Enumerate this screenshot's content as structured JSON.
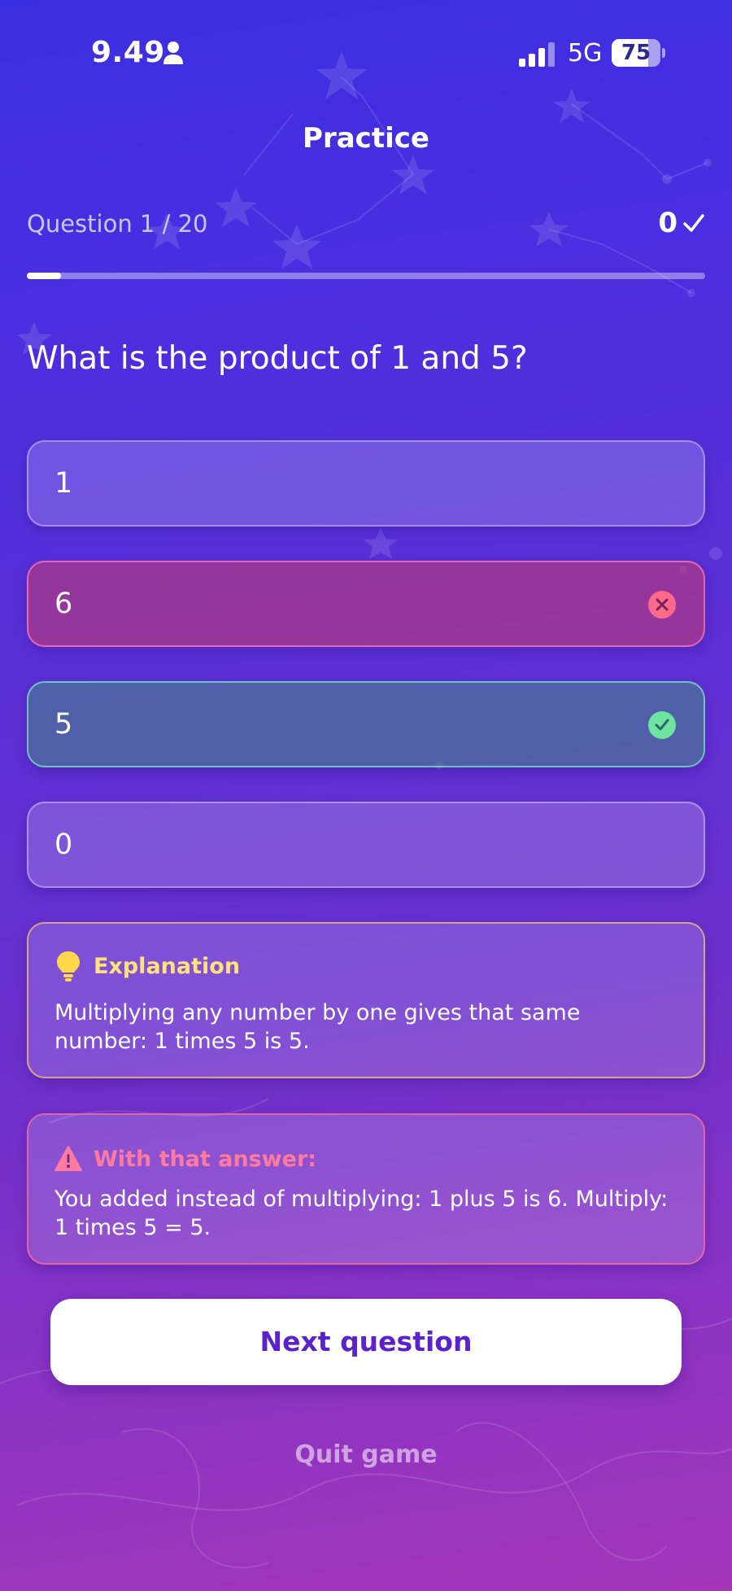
{
  "status_bar": {
    "time": "9.49",
    "network": "5G",
    "battery_percent": 75,
    "battery_label": "75"
  },
  "header": {
    "title": "Practice",
    "question_counter": "Question 1 / 20",
    "score": "0",
    "progress_fraction": 0.05
  },
  "question": {
    "text": "What is the product of 1 and 5?"
  },
  "answers": [
    {
      "label": "1",
      "state": "neutral"
    },
    {
      "label": "6",
      "state": "wrong"
    },
    {
      "label": "5",
      "state": "correct"
    },
    {
      "label": "0",
      "state": "neutral"
    }
  ],
  "explanation": {
    "title": "Explanation",
    "body": "Multiplying any number by one gives that same number: 1 times 5 is 5.",
    "icon": "lightbulb-icon"
  },
  "wrong_answer_feedback": {
    "title": "With that answer:",
    "body": "You added instead of multiplying: 1 plus 5 is 6. Multiply: 1 times 5 = 5.",
    "icon": "warning-icon"
  },
  "actions": {
    "next_label": "Next question",
    "quit_label": "Quit game"
  },
  "colors": {
    "background_top": "#3a2fe0",
    "background_bottom": "#a436b8",
    "accent_button_text": "#5a22c8",
    "correct": "#6fe3a0",
    "wrong": "#ff6a8a",
    "explanation_title": "#ffe27a",
    "warning_title": "#ff7a9e"
  }
}
